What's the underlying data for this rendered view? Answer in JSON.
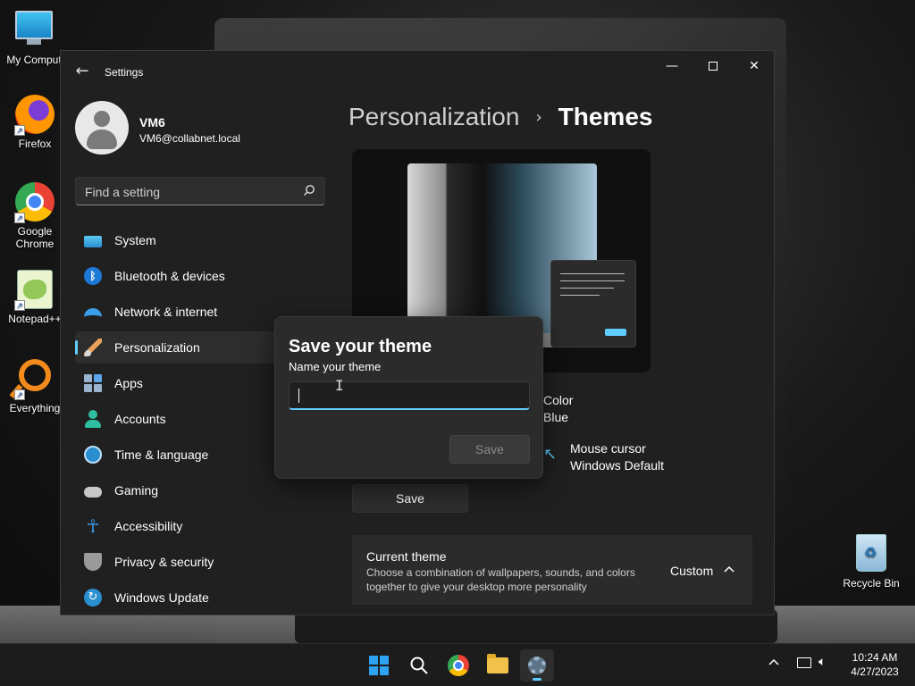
{
  "desktop": {
    "icons": [
      {
        "label": "My Comput"
      },
      {
        "label": "Firefox"
      },
      {
        "label": "Google Chrome"
      },
      {
        "label": "Notepad++"
      },
      {
        "label": "Everything"
      },
      {
        "label": "Recycle Bin"
      }
    ]
  },
  "window": {
    "title": "Settings",
    "back_icon": "back-arrow-icon",
    "minimize_glyph": "—",
    "close_glyph": "✕"
  },
  "profile": {
    "name": "VM6",
    "email": "VM6@collabnet.local"
  },
  "search": {
    "placeholder": "Find a setting"
  },
  "nav": {
    "items": [
      {
        "label": "System",
        "icon": "system-icon"
      },
      {
        "label": "Bluetooth & devices",
        "icon": "bluetooth-icon"
      },
      {
        "label": "Network & internet",
        "icon": "wifi-icon"
      },
      {
        "label": "Personalization",
        "icon": "brush-icon",
        "active": true
      },
      {
        "label": "Apps",
        "icon": "apps-icon"
      },
      {
        "label": "Accounts",
        "icon": "accounts-icon"
      },
      {
        "label": "Time & language",
        "icon": "clock-globe-icon"
      },
      {
        "label": "Gaming",
        "icon": "gamepad-icon"
      },
      {
        "label": "Accessibility",
        "icon": "accessibility-icon"
      },
      {
        "label": "Privacy & security",
        "icon": "shield-icon"
      },
      {
        "label": "Windows Update",
        "icon": "update-icon"
      }
    ]
  },
  "main": {
    "breadcrumb_parent": "Personalization",
    "breadcrumb_separator": "›",
    "breadcrumb_current": "Themes",
    "settings": [
      {
        "label": "Color",
        "value": "Blue",
        "icon": "palette-icon"
      },
      {
        "label": "Mouse cursor",
        "value": "Windows Default",
        "icon": "cursor-icon"
      }
    ],
    "save_label": "Save",
    "current_theme": {
      "title": "Current theme",
      "description": "Choose a combination of wallpapers, sounds, and colors together to give your desktop more personality",
      "value": "Custom",
      "chevron": "^"
    }
  },
  "dialog": {
    "title": "Save your theme",
    "field_label": "Name your theme",
    "field_value": "",
    "save_label": "Save"
  },
  "taskbar": {
    "apps": [
      "start",
      "search",
      "chrome",
      "file-explorer",
      "settings"
    ],
    "time": "10:24 AM",
    "date": "4/27/2023"
  },
  "colors": {
    "accent": "#60cdff",
    "window_bg": "#202020",
    "dialog_bg": "#2b2b2b"
  }
}
